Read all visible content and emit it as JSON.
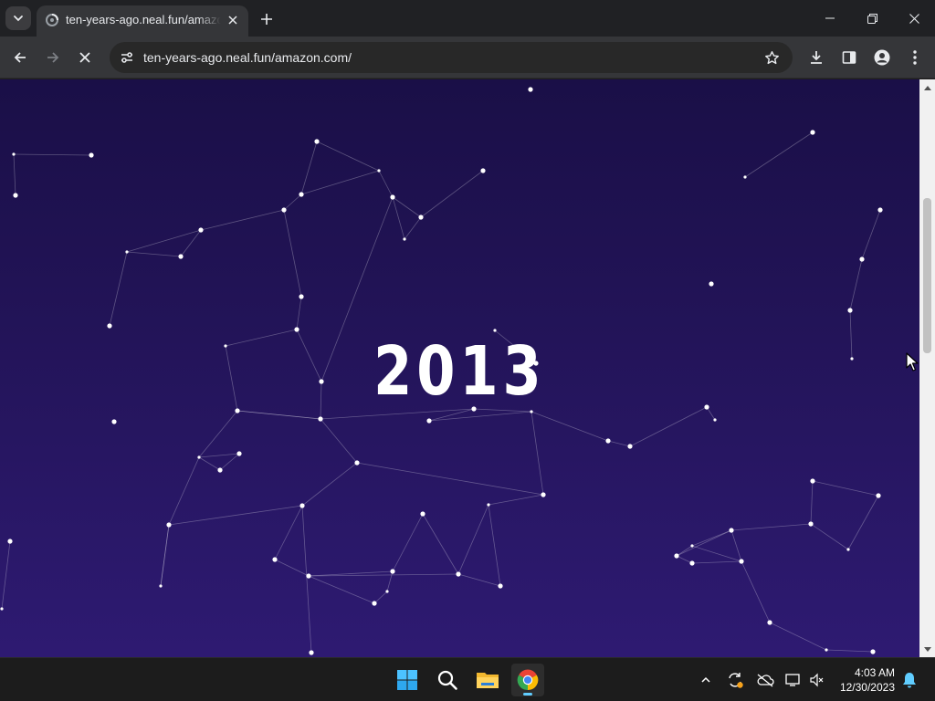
{
  "browser": {
    "tab": {
      "title": "ten-years-ago.neal.fun/amazon.com/",
      "favicon": "loading-spinner-icon"
    },
    "url": "ten-years-ago.neal.fun/amazon.com/",
    "icons": {
      "tab_search": "chevron-down-icon",
      "new_tab": "plus-icon",
      "back": "arrow-left-icon",
      "forward": "arrow-right-icon",
      "stop": "close-icon",
      "site_info": "tune-icon",
      "bookmark": "star-icon",
      "downloads": "download-icon",
      "side_panel": "side-panel-icon",
      "profile": "profile-icon",
      "menu": "kebab-menu-icon"
    }
  },
  "page": {
    "year": "2013",
    "background_top": "#1a0f47",
    "background_bottom": "#2e1a72",
    "star_color": "#ffffff"
  },
  "taskbar": {
    "apps": [
      "start-icon",
      "search-icon",
      "file-explorer-icon",
      "chrome-icon"
    ],
    "active_app": "chrome-icon",
    "tray": [
      "chevron-up-icon",
      "sync-icon",
      "onedrive-icon",
      "display-icon",
      "volume-muted-icon",
      "bell-icon"
    ],
    "time": "4:03 AM",
    "date": "12/30/2023"
  }
}
